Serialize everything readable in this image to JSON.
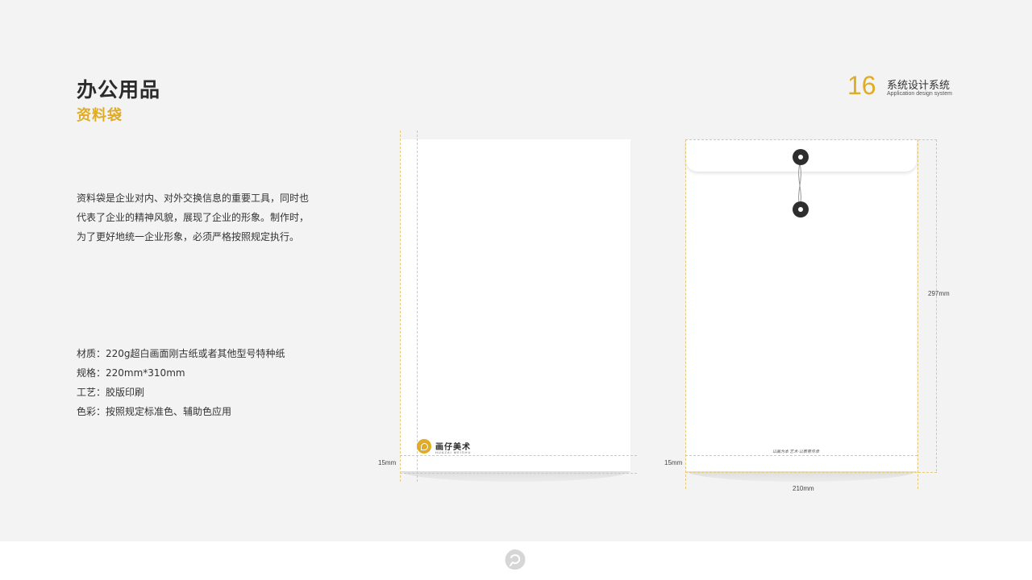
{
  "header": {
    "title": "办公用品",
    "subtitle": "资料袋",
    "page_number": "16",
    "section_title": "系统设计系统",
    "section_subtitle": "Application design system"
  },
  "description": {
    "lines": [
      "资料袋是企业对内、对外交换信息的重要工具，同时也",
      "代表了企业的精神风貌，展现了企业的形象。制作时，",
      "为了更好地统一企业形象，必须严格按照规定执行。"
    ]
  },
  "specs": {
    "material": "材质：220g超白画面刚古纸或者其他型号特种纸",
    "size": "规格：220mm*310mm",
    "process": "工艺：胶版印刷",
    "color": "色彩：按照规定标准色、辅助色应用"
  },
  "front": {
    "logo_cn": "画仔美术",
    "logo_en": "HUAZAI MEISHU",
    "margin_label": "15mm"
  },
  "back": {
    "slogan": "以画为本 艺术·以教育传承",
    "margin_label": "15mm",
    "height_label": "297mm",
    "width_label": "210mm"
  },
  "colors": {
    "accent": "#e0ac26",
    "background": "#f3f3f3",
    "button": "#2e2e2e"
  },
  "icons": {
    "brand": "brand-logo-icon",
    "footer": "footer-logo-icon"
  }
}
